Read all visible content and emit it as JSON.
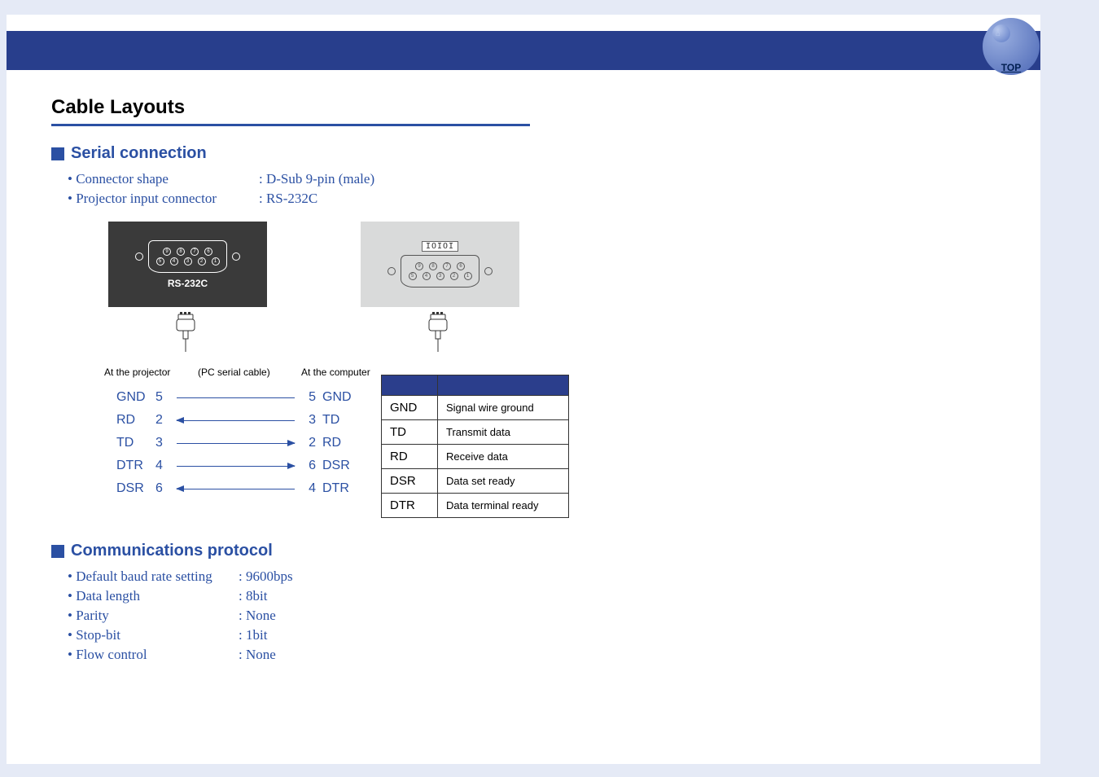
{
  "header": {
    "top_link": "TOP"
  },
  "titles": {
    "main": "Cable Layouts",
    "serial": "Serial connection",
    "protocol": "Communications protocol"
  },
  "serial_specs": [
    {
      "label": "• Connector shape",
      "value": ": D-Sub 9-pin (male)"
    },
    {
      "label": "• Projector input connector",
      "value": ": RS-232C"
    }
  ],
  "connector_labels": {
    "rs232c": "RS-232C",
    "ioi": "IOIOI"
  },
  "pin_numbers": {
    "dark_top": [
      "9",
      "8",
      "7",
      "6"
    ],
    "dark_bottom": [
      "5",
      "4",
      "3",
      "2",
      "1"
    ],
    "light_top": [
      "9",
      "8",
      "7",
      "6"
    ],
    "light_bottom": [
      "5",
      "4",
      "3",
      "2",
      "1"
    ]
  },
  "pinout_headers": {
    "left": "At the projector",
    "mid": "(PC serial cable)",
    "right": "At the computer"
  },
  "pinout": [
    {
      "llabel": "GND",
      "lnum": "5",
      "arrow": "none",
      "rnum": "5",
      "rlabel": "GND"
    },
    {
      "llabel": "RD",
      "lnum": "2",
      "arrow": "left",
      "rnum": "3",
      "rlabel": "TD"
    },
    {
      "llabel": "TD",
      "lnum": "3",
      "arrow": "right",
      "rnum": "2",
      "rlabel": "RD"
    },
    {
      "llabel": "DTR",
      "lnum": "4",
      "arrow": "right",
      "rnum": "6",
      "rlabel": "DSR"
    },
    {
      "llabel": "DSR",
      "lnum": "6",
      "arrow": "left",
      "rnum": "4",
      "rlabel": "DTR"
    }
  ],
  "signal_table": [
    {
      "abbr": "GND",
      "desc": "Signal wire ground"
    },
    {
      "abbr": "TD",
      "desc": "Transmit data"
    },
    {
      "abbr": "RD",
      "desc": "Receive data"
    },
    {
      "abbr": "DSR",
      "desc": "Data set ready"
    },
    {
      "abbr": "DTR",
      "desc": "Data terminal ready"
    }
  ],
  "protocol_specs": [
    {
      "label": "• Default baud rate setting",
      "value": ": 9600bps"
    },
    {
      "label": "• Data length",
      "value": ": 8bit"
    },
    {
      "label": "• Parity",
      "value": ": None"
    },
    {
      "label": "• Stop-bit",
      "value": ": 1bit"
    },
    {
      "label": "• Flow control",
      "value": ": None"
    }
  ]
}
